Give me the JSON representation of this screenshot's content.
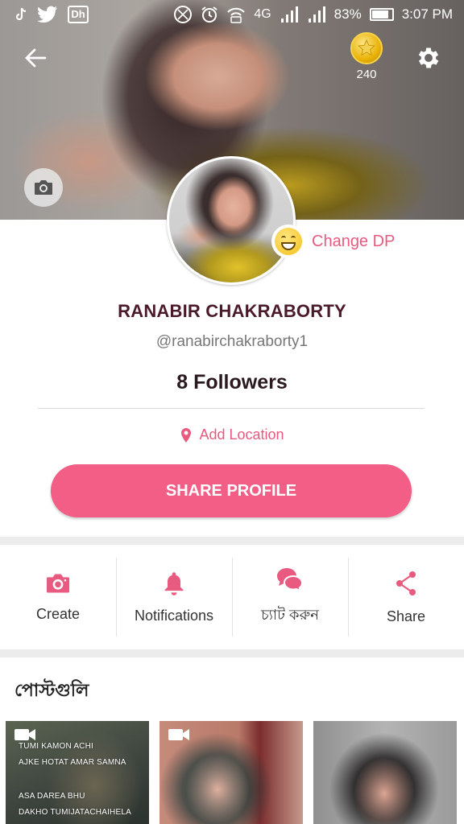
{
  "status_bar": {
    "battery": "83%",
    "time": "3:07 PM",
    "network": "4G",
    "sim_badge": "Dh"
  },
  "header": {
    "coins": "240"
  },
  "profile": {
    "change_dp_label": "Change DP",
    "name": "RANABIR CHAKRABORTY",
    "handle": "@ranabirchakraborty1",
    "followers": "8 Followers",
    "location_label": "Add Location",
    "share_button": "SHARE PROFILE"
  },
  "actions": [
    {
      "label": "Create",
      "icon": "camera-icon"
    },
    {
      "label": "Notifications",
      "icon": "bell-icon"
    },
    {
      "label": "চ্যাট করুন",
      "icon": "chat-icon"
    },
    {
      "label": "Share",
      "icon": "share-icon"
    }
  ],
  "posts": {
    "title": "পোস্টগুলি",
    "items": [
      {
        "type": "video",
        "overlay": [
          "TUMI KAMON ACHI",
          "AJKE HOTAT AMAR SAMNA",
          "ASA DAREA BHU",
          "DAKHO TUMIJATACHAIHELA"
        ]
      },
      {
        "type": "video",
        "overlay": []
      },
      {
        "type": "image",
        "overlay": []
      }
    ]
  },
  "colors": {
    "accent": "#f25e86",
    "accent_text": "#e85a80",
    "name_color": "#4a1a2a"
  }
}
